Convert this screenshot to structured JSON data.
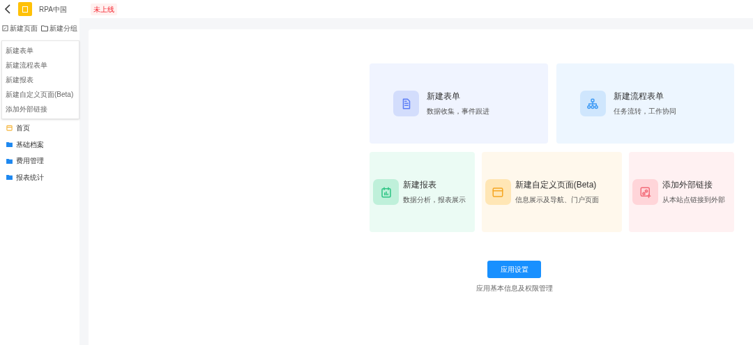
{
  "header": {
    "app_name": "RPA中国",
    "status_badge": "未上线"
  },
  "sidebar": {
    "actions": [
      {
        "kind": "page",
        "label": "新建页面"
      },
      {
        "kind": "group",
        "label": "新建分组"
      }
    ],
    "items": [
      {
        "kind": "home",
        "label": "首页"
      },
      {
        "kind": "folder",
        "label": "基础档案"
      },
      {
        "kind": "folder",
        "label": "费用管理"
      },
      {
        "kind": "folder",
        "label": "报表统计"
      }
    ]
  },
  "dropdown_menu": {
    "items": [
      "新建表单",
      "新建流程表单",
      "新建报表",
      "新建自定义页面(Beta)",
      "添加外部链接"
    ]
  },
  "cards": [
    {
      "kind": "form",
      "title": "新建表单",
      "subtitle": "数据收集，事件跟进"
    },
    {
      "kind": "flow",
      "title": "新建流程表单",
      "subtitle": "任务流转，工作协同"
    },
    {
      "kind": "report",
      "title": "新建报表",
      "subtitle": "数据分析，报表展示"
    },
    {
      "kind": "page",
      "title": "新建自定义页面(Beta)",
      "subtitle": "信息展示及导航、门户页面"
    },
    {
      "kind": "link",
      "title": "添加外部链接",
      "subtitle": "从本站点链接到外部"
    }
  ],
  "settings": {
    "button": "应用设置",
    "caption": "应用基本信息及权限管理"
  }
}
